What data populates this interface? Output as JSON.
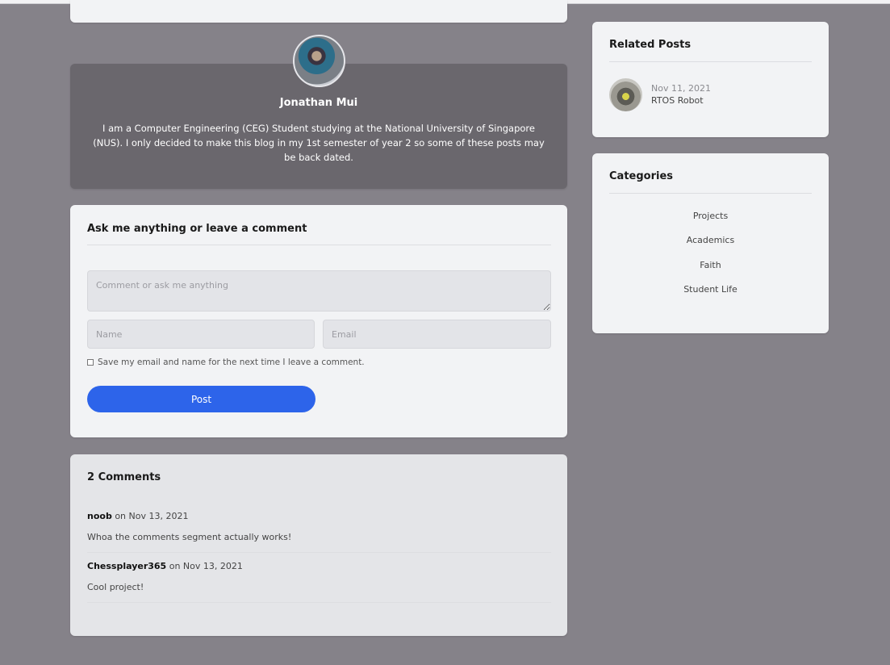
{
  "author": {
    "name": "Jonathan Mui",
    "bio": "I am a Computer Engineering (CEG) Student studying at the National University of Singapore (NUS). I only decided to make this blog in my 1st semester of year 2 so some of these posts may be back dated."
  },
  "comment_form": {
    "title": "Ask me anything or leave a comment",
    "comment_placeholder": "Comment or ask me anything",
    "name_placeholder": "Name",
    "email_placeholder": "Email",
    "save_label": "Save my email and name for the next time I leave a comment.",
    "post_label": "Post",
    "accent_color": "#2d64ea"
  },
  "comments": {
    "title": "2 Comments",
    "items": [
      {
        "author": "noob",
        "date": "on Nov 13, 2021",
        "text": "Whoa the comments segment actually works!"
      },
      {
        "author": "Chessplayer365",
        "date": "on Nov 13, 2021",
        "text": "Cool project!"
      }
    ]
  },
  "related": {
    "title": "Related Posts",
    "items": [
      {
        "date": "Nov 11, 2021",
        "title": "RTOS Robot"
      }
    ]
  },
  "categories": {
    "title": "Categories",
    "items": [
      "Projects",
      "Academics",
      "Faith",
      "Student Life"
    ]
  }
}
